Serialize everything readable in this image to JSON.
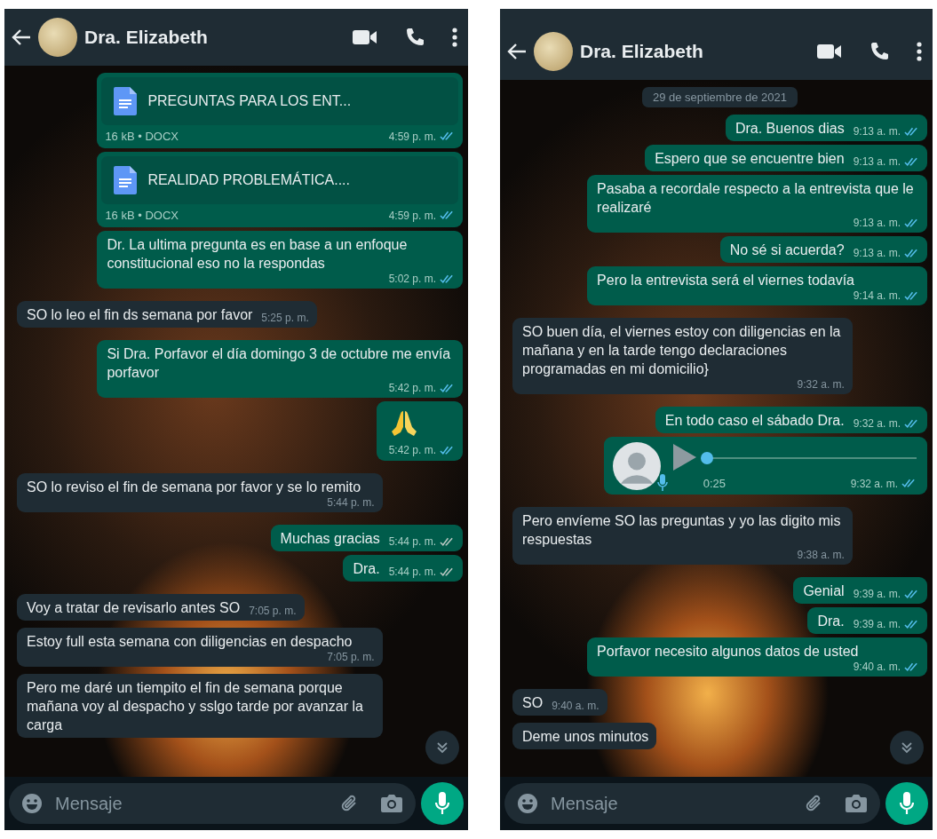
{
  "panels": [
    {
      "status_bar": false,
      "header": {
        "title": "Dra. Elizabeth"
      },
      "messages": [
        {
          "kind": "document",
          "outgoing": true,
          "read": true,
          "file_name": "PREGUNTAS PARA LOS ENT...",
          "meta": "16 kB • DOCX",
          "time": "4:59 p. m."
        },
        {
          "kind": "document",
          "outgoing": true,
          "read": true,
          "file_name": "REALIDAD PROBLEMÁTICA....",
          "meta": "16 kB • DOCX",
          "time": "4:59 p. m."
        },
        {
          "kind": "text",
          "outgoing": true,
          "read": true,
          "text": "Dr. La ultima pregunta es en base a un enfoque constitucional eso no la respondas",
          "time": "5:02 p. m."
        },
        {
          "kind": "text",
          "outgoing": false,
          "text": "SO lo leo el fin ds semana por favor",
          "time": "5:25 p. m."
        },
        {
          "kind": "text",
          "outgoing": true,
          "read": true,
          "text": "Si Dra. Porfavor el día domingo 3 de octubre me envía porfavor",
          "time": "5:42 p. m."
        },
        {
          "kind": "emoji",
          "outgoing": true,
          "read": true,
          "time": "5:42 p. m."
        },
        {
          "kind": "text",
          "outgoing": false,
          "text": "SO lo reviso el fin de semana por favor y se lo remito",
          "time": "5:44 p. m."
        },
        {
          "kind": "text",
          "outgoing": true,
          "read": false,
          "text": "Muchas gracias",
          "time": "5:44 p. m."
        },
        {
          "kind": "text",
          "outgoing": true,
          "read": false,
          "text": "Dra.",
          "time": "5:44 p. m."
        },
        {
          "kind": "text",
          "outgoing": false,
          "text": "Voy a tratar de revisarlo antes SO",
          "time": "7:05 p. m."
        },
        {
          "kind": "text",
          "outgoing": false,
          "text": "Estoy full esta semana con diligencias en despacho",
          "time": "7:05 p. m."
        },
        {
          "kind": "text",
          "outgoing": false,
          "text": "Pero me daré un tiempito el fin de semana porque mañana voy al despacho y sslgo tarde por avanzar la carga"
        }
      ],
      "input": {
        "placeholder": "Mensaje"
      }
    },
    {
      "status_bar": true,
      "header": {
        "title": "Dra. Elizabeth"
      },
      "date": "29 de septiembre de 2021",
      "messages": [
        {
          "kind": "text",
          "outgoing": true,
          "read": true,
          "text": "Dra. Buenos dias",
          "time": "9:13 a. m."
        },
        {
          "kind": "text",
          "outgoing": true,
          "read": true,
          "text": "Espero que se encuentre bien",
          "time": "9:13 a. m."
        },
        {
          "kind": "text",
          "outgoing": true,
          "read": true,
          "text": "Pasaba a recordale respecto a la entrevista que le realizaré",
          "time": "9:13 a. m."
        },
        {
          "kind": "text",
          "outgoing": true,
          "read": true,
          "text": "No sé si acuerda?",
          "time": "9:13 a. m."
        },
        {
          "kind": "text",
          "outgoing": true,
          "read": true,
          "text": "Pero la entrevista será el viernes todavía",
          "time": "9:14 a. m."
        },
        {
          "kind": "text",
          "outgoing": false,
          "text": "SO buen día, el viernes estoy con diligencias en la mañana y en la tarde tengo declaraciones programadas en mi domicilio}",
          "time": "9:32 a. m."
        },
        {
          "kind": "text",
          "outgoing": true,
          "read": true,
          "text": "En todo caso el sábado Dra.",
          "time": "9:32 a. m."
        },
        {
          "kind": "voice",
          "outgoing": true,
          "read": true,
          "duration": "0:25",
          "level": 0,
          "time": "9:32 a. m."
        },
        {
          "kind": "text",
          "outgoing": false,
          "text": "Pero envíeme SO las preguntas y yo las digito mis respuestas",
          "time": "9:38 a. m."
        },
        {
          "kind": "text",
          "outgoing": true,
          "read": true,
          "text": "Genial",
          "time": "9:39 a. m."
        },
        {
          "kind": "text",
          "outgoing": true,
          "read": true,
          "text": "Dra.",
          "time": "9:39 a. m."
        },
        {
          "kind": "text",
          "outgoing": true,
          "read": true,
          "text": "Porfavor necesito algunos datos de usted",
          "time": "9:40 a. m."
        },
        {
          "kind": "text",
          "outgoing": false,
          "text": "SO",
          "time": "9:40 a. m."
        },
        {
          "kind": "text",
          "outgoing": false,
          "text": "Deme unos minutos"
        }
      ],
      "input": {
        "placeholder": "Mensaje"
      }
    }
  ]
}
